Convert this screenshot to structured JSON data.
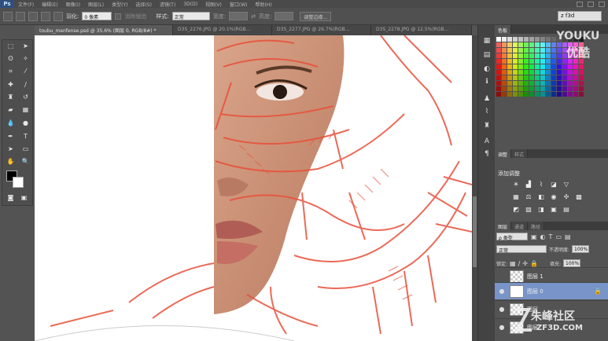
{
  "app": {
    "logo": "Ps",
    "menu": [
      "文件(F)",
      "编辑(E)",
      "图像(I)",
      "图层(L)",
      "类型(Y)",
      "选择(S)",
      "滤镜(T)",
      "3D(D)",
      "视图(V)",
      "窗口(W)",
      "帮助(H)"
    ]
  },
  "options": {
    "feather_label": "羽化:",
    "feather_value": "0 像素",
    "antialias_label": "消除锯齿",
    "style_label": "样式:",
    "style_value": "正常",
    "width_label": "宽度:",
    "height_label": "高度:",
    "refine_edge_label": "调整边缘...",
    "workspace_value": "z f3d"
  },
  "tabs": [
    {
      "label": "toubu_manfense.psd @ 35.6% (图层 0, RGB/8#) *",
      "active": true
    },
    {
      "label": "D3S_2276.JPG @ 20.1%(RGB...",
      "active": false
    },
    {
      "label": "D3S_2277.JPG @ 26.7%(RGB...",
      "active": false
    },
    {
      "label": "D3S_2278.JPG @ 12.5%(RGB...",
      "active": false
    }
  ],
  "panels": {
    "swatches_tabs": [
      "色板"
    ],
    "adjust_tabs": [
      "调整",
      "样式"
    ],
    "adjust_title": "添加调整",
    "layer_tabs": [
      "图层",
      "通道",
      "路径"
    ],
    "kind_value": "ρ 类型",
    "blend_value": "正常",
    "opacity_label": "不透明度:",
    "opacity_value": "100%",
    "lock_label": "锁定:",
    "fill_label": "填充:",
    "fill_value": "100%"
  },
  "layers": [
    {
      "name": "图层 1",
      "selected": false,
      "visible": false
    },
    {
      "name": "图层 0",
      "selected": true,
      "visible": true
    },
    {
      "name": "图层",
      "selected": false,
      "visible": true
    },
    {
      "name": "图层",
      "selected": false,
      "visible": true
    }
  ],
  "watermarks": {
    "youku_latin": "YOUKU",
    "youku_cn": "优酷",
    "brand_cn": "朱峰社区",
    "brand_url": "ZF3D.COM"
  },
  "colors": {
    "accent_selected": "#7894c8",
    "line_red": "#e8503a"
  }
}
